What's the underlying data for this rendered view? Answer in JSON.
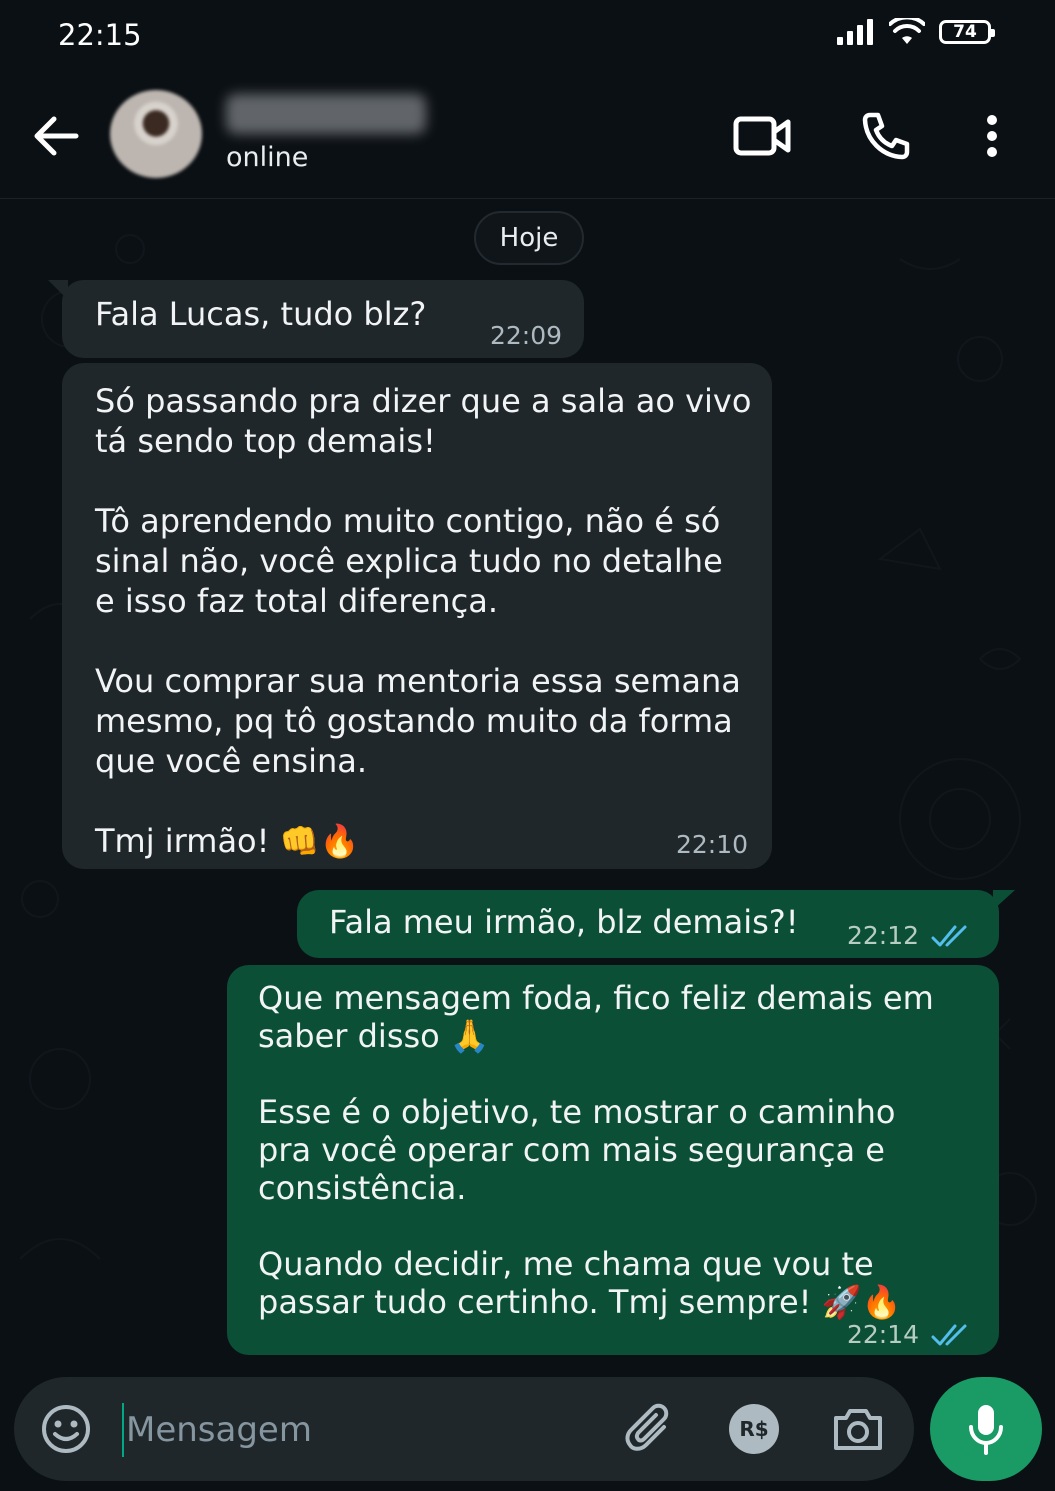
{
  "status_bar": {
    "time": "22:15",
    "battery": "74"
  },
  "header": {
    "contact_status": "online"
  },
  "chat": {
    "date_divider": "Hoje",
    "messages": [
      {
        "direction": "in",
        "text": "Fala Lucas, tudo blz?",
        "time": "22:09"
      },
      {
        "direction": "in",
        "text": "Só passando pra dizer que a sala ao vivo\ntá sendo top demais!\n\nTô aprendendo muito contigo, não é só\nsinal não, você explica tudo no detalhe\ne isso faz total diferença.\n\nVou comprar sua mentoria essa semana\nmesmo, pq tô gostando muito da forma\nque você ensina.\n\nTmj irmão! 👊🔥",
        "time": "22:10"
      },
      {
        "direction": "out",
        "text": "Fala meu irmão, blz demais?!",
        "time": "22:12",
        "read": true
      },
      {
        "direction": "out",
        "text": "Que mensagem foda, fico feliz demais em\nsaber disso 🙏\n\nEsse é o objetivo, te mostrar o caminho\npra você operar com mais segurança e\nconsistência.\n\nQuando decidir, me chama que vou te\npassar tudo certinho. Tmj sempre! 🚀🔥",
        "time": "22:14",
        "read": true
      }
    ]
  },
  "composer": {
    "placeholder": "Mensagem",
    "payment_label": "R$"
  },
  "colors": {
    "incoming": "#1f272a",
    "outgoing": "#0b5036",
    "accent": "#1a9a64",
    "read_ticks": "#53bdeb"
  },
  "icons": [
    "back-arrow-icon",
    "video-call-icon",
    "phone-icon",
    "more-options-icon",
    "emoji-icon",
    "attach-icon",
    "payment-icon",
    "camera-icon",
    "mic-icon",
    "double-check-icon"
  ]
}
